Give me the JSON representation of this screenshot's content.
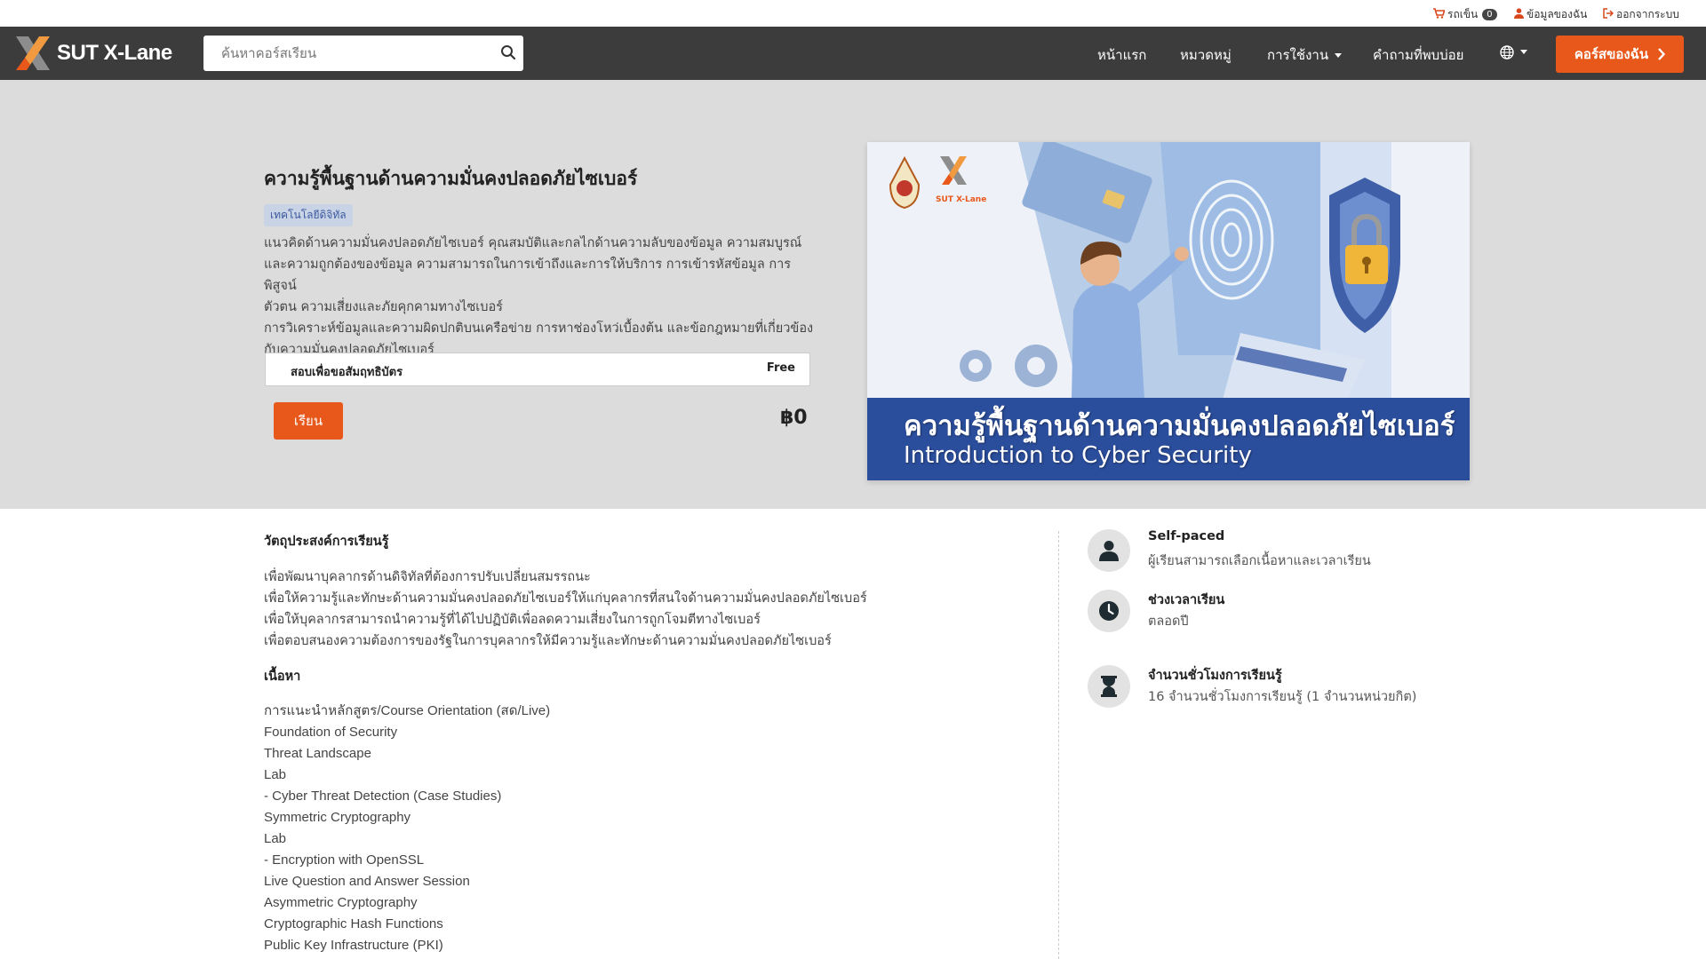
{
  "topbar": {
    "cart_label": "รถเข็น",
    "cart_count": "0",
    "profile_label": "ข้อมูลของฉัน",
    "logout_label": "ออกจากระบบ"
  },
  "navbar": {
    "brand": "SUT X-Lane",
    "search_placeholder": "ค้นหาคอร์สเรียน",
    "links": [
      "หน้าแรก",
      "หมวดหมู่",
      "การใช้งาน",
      "คำถามที่พบบ่อย"
    ],
    "my_courses_label": "คอร์สของฉัน"
  },
  "course": {
    "title": "ความรู้พื้นฐานด้านความมั่นคงปลอดภัยไซเบอร์",
    "category": "เทคโนโลยีดิจิทัล",
    "description_lines": [
      "แนวคิดด้านความมั่นคงปลอดภัยไซเบอร์ คุณสมบัติและกลไกด้านความลับของข้อมูล ความสมบูรณ์",
      "และความถูกต้องของข้อมูล ความสามารถในการเข้าถึงและการให้บริการ การเข้ารหัสข้อมูล การพิสูจน์",
      "ตัวตน ความเสี่ยงและภัยคุกคามทางไซเบอร์",
      "การวิเคราะห์ข้อมูลและความผิดปกติบนเครือข่าย การหาช่องโหว่เบื้องต้น และข้อกฎหมายที่เกี่ยวข้อง",
      "กับความมั่นคงปลอดภัยไซเบอร์"
    ],
    "option_label": "สอบเพื่อขอสัมฤทธิบัตร",
    "option_price": "Free",
    "study_button": "เรียน",
    "price": "฿0"
  },
  "banner": {
    "title_th": "ความรู้พื้นฐานด้านความมั่นคงปลอดภัยไซเบอร์",
    "title_en": "Introduction to Cyber Security",
    "logo_text": "SUT X-Lane"
  },
  "objectives": {
    "heading": "วัตถุประสงค์การเรียนรู้",
    "items": [
      "เพื่อพัฒนาบุคลากรด้านดิจิทัลที่ต้องการปรับเปลี่ยนสมรรถนะ",
      "เพื่อให้ความรู้และทักษะด้านความมั่นคงปลอดภัยไซเบอร์ให้แก่บุคลากรที่สนใจด้านความมั่นคงปลอดภัยไซเบอร์",
      "เพื่อให้บุคลากรสามารถนำความรู้ที่ได้ไปปฏิบัติเพื่อลดความเสี่ยงในการถูกโจมตีทางไซเบอร์",
      "เพื่อตอบสนองความต้องการของรัฐในการบุคลากรให้มีความรู้และทักษะด้านความมั่นคงปลอดภัยไซเบอร์"
    ]
  },
  "contents": {
    "heading": "เนื้อหา",
    "items": [
      "การแนะนำหลักสูตร/Course Orientation (สด/Live)",
      "Foundation of Security",
      "Threat Landscape",
      "Lab",
      "- Cyber Threat Detection (Case Studies)",
      "Symmetric Cryptography",
      "Lab",
      "- Encryption with OpenSSL",
      "Live Question and Answer Session",
      "Asymmetric Cryptography",
      "Cryptographic Hash Functions",
      "Public Key Infrastructure (PKI)"
    ]
  },
  "info": [
    {
      "icon": "person-icon",
      "title": "Self-paced",
      "sub": "ผู้เรียนสามารถเลือกเนื้อหาและเวลาเรียน"
    },
    {
      "icon": "clock-icon",
      "title": "ช่วงเวลาเรียน",
      "sub": "ตลอดปี"
    },
    {
      "icon": "hourglass-icon",
      "title": "จำนวนชั่วโมงการเรียนรู้",
      "sub": "16 จำนวนชั่วโมงการเรียนรู้ (1 จำนวนหน่วยกิต)"
    }
  ],
  "colors": {
    "accent": "#e8581b",
    "navbar": "#3c3c3c",
    "hero_bg": "#dcdcdc",
    "banner_strip": "#2b4e9c"
  }
}
